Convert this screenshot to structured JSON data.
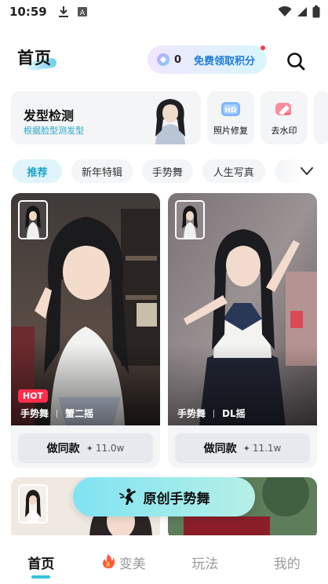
{
  "status_bar": {
    "time": "10:59"
  },
  "header": {
    "title": "首页",
    "points_value": "0",
    "points_label": "免费领取积分"
  },
  "features": {
    "hair": {
      "title": "发型检测",
      "subtitle": "根据脸型测发型"
    },
    "photo_repair": {
      "label": "照片修复",
      "badge": "HD"
    },
    "watermark": {
      "label": "去水印"
    }
  },
  "tabs": [
    {
      "label": "推荐",
      "active": true
    },
    {
      "label": "新年特辑"
    },
    {
      "label": "手势舞"
    },
    {
      "label": "人生写真"
    },
    {
      "label": ""
    }
  ],
  "videos": [
    {
      "badge": "HOT",
      "tag1": "手势舞",
      "tag2": "蟹二摇",
      "button": "做同款",
      "count": "11.0w"
    },
    {
      "badge": "",
      "tag1": "手势舞",
      "tag2": "DL摇",
      "button": "做同款",
      "count": "11.1w"
    }
  ],
  "float_button": {
    "label": "原创手势舞"
  },
  "bottom_nav": [
    {
      "label": "首页",
      "active": true
    },
    {
      "label": "变美"
    },
    {
      "label": "玩法"
    },
    {
      "label": "我的"
    }
  ],
  "colors": {
    "accent": "#35c2dc",
    "hot": "#ff2e4d",
    "points_link": "#1e7bd8"
  }
}
